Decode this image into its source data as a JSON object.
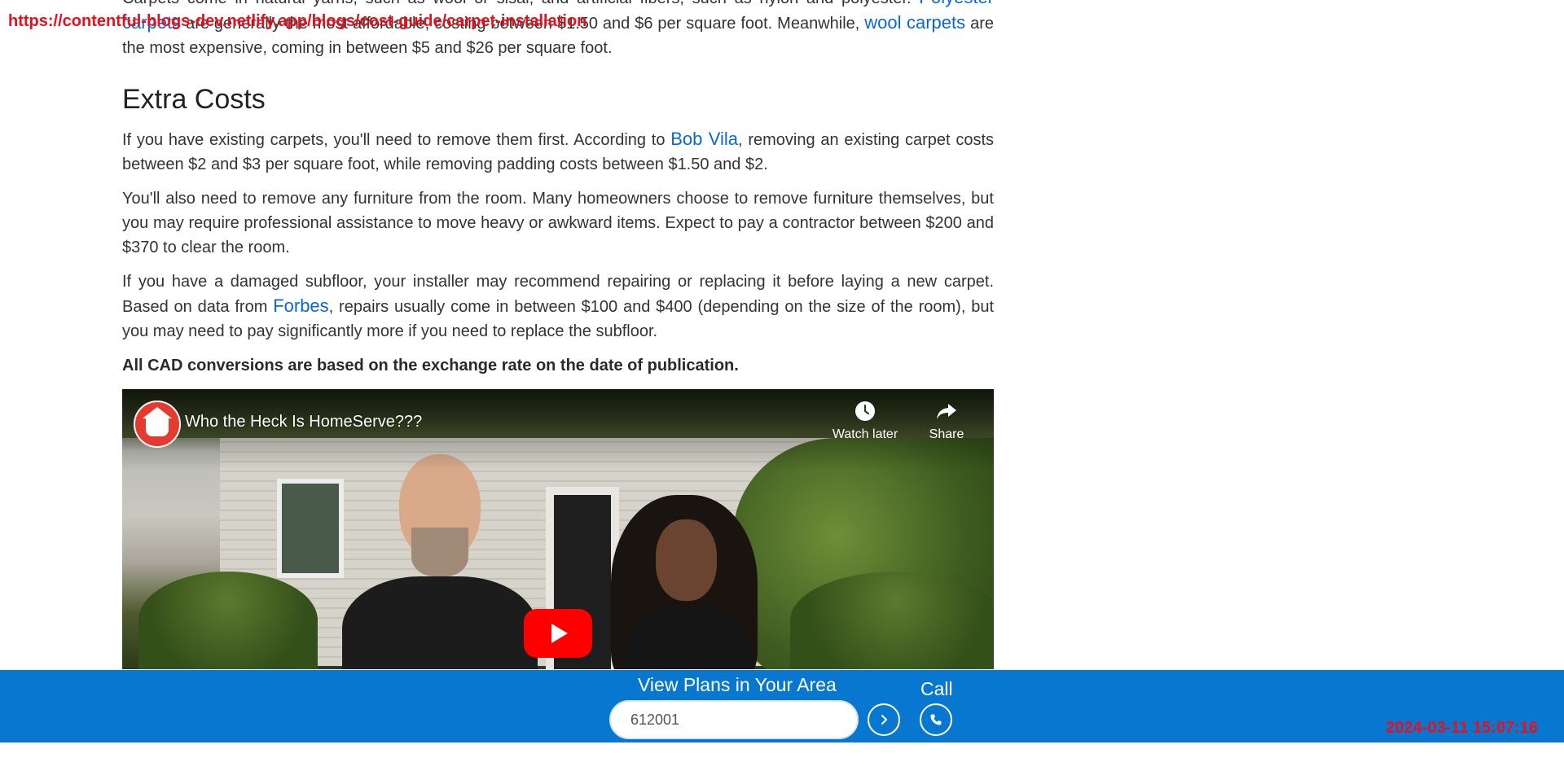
{
  "overlay": {
    "url": "https://contentful-blogs-dev.netlify.app/blogs/cost-guide/carpet-installation",
    "timestamp": "2024-03-11 15:07:16"
  },
  "article": {
    "intro_partial_line1": "Carpets come in natural yarns, such as wool or sisal, and artificial fibers, such as nylon and polyester. ",
    "intro_link_polyester": "Polyester carpets",
    "intro_partial_line2": " are generally the most affordable, costing between $1.50 and $6 per square foot. Meanwhile, ",
    "intro_link_wool": "wool carpets",
    "intro_partial_line3": " are the most expensive, coming in between $5 and $26 per square foot.",
    "heading": "Extra Costs",
    "p1_a": "If you have existing carpets, you'll need to remove them first. According to ",
    "p1_link": "Bob Vila",
    "p1_b": ", removing an existing carpet costs between $2 and $3 per square foot, while removing padding costs between $1.50 and $2.",
    "p2": "You'll also need to remove any furniture from the room. Many homeowners choose to remove furniture themselves, but you may require professional assistance to move heavy or awkward items. Expect to pay a contractor between $200 and $370 to clear the room.",
    "p3_a": "If you have a damaged subfloor, your installer may recommend repairing or replacing it before laying a new carpet. Based on data from ",
    "p3_link": "Forbes",
    "p3_b": ", repairs usually come in between $100 and $400 (depending on the size of the room), but you may need to pay significantly more if you need to replace the subfloor.",
    "note": "All CAD conversions are based on the exchange rate on the date of publication."
  },
  "video": {
    "title": "Who the Heck Is HomeServe???",
    "watch_later": "Watch later",
    "share": "Share",
    "channel_icon": "homeserve-house-icon",
    "play_icon": "youtube-play-icon"
  },
  "plans_bar": {
    "title": "View Plans in Your Area",
    "zip_value": "612001",
    "call_label": "Call",
    "go_icon": "chevron-right-icon",
    "call_icon": "phone-icon",
    "color": "#0777d0"
  }
}
